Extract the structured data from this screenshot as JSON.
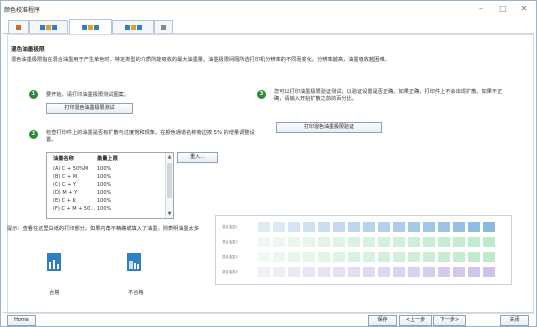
{
  "window": {
    "title": "颜色校准程序",
    "controls": [
      "–",
      "□",
      "✕"
    ]
  },
  "tabs": [
    {
      "icons": [
        "printer"
      ],
      "active": false
    },
    {
      "icons": [
        "arrow",
        "arrow",
        "arrow"
      ],
      "active": false
    },
    {
      "icons": [
        "arrow",
        "arrow",
        "arrow"
      ],
      "active": true
    },
    {
      "icons": [
        "arrow",
        "arrow",
        "arrow"
      ],
      "active": false
    },
    {
      "icons": [
        "grid"
      ],
      "active": false
    }
  ],
  "content": {
    "heading": "混色油墨极限",
    "description": "混色油墨极限指在混合油墨用于产生单色时，特定类型的介质所能吸收的最大油墨量。油墨极限间隔所选打印机分辨率的不同而变化。分辨率越高，油墨吸收越困难。",
    "step1": {
      "text": "要开始，请打印油墨极限测试图案。",
      "button": "打印混色油墨极限测试"
    },
    "step2": {
      "text": "检查打印件上的油墨是否有扩散与过度饱和现象。在颜色通道名称旁边按 5% 的增量调整设置。",
      "button": "重入..."
    },
    "step3": {
      "text": "您可以打印油墨极限验证测试，以验证设置是否正确。如果正确，打印件上不会出现扩散。如果不正确，请输入开始扩散之前的百分比。",
      "button": "打印混色油墨极限验证"
    },
    "table": {
      "headers": [
        "油墨名称",
        "墨量上限"
      ],
      "rows": [
        [
          "(A) C + 50%M",
          "100%"
        ],
        [
          "(B) C + M",
          "100%"
        ],
        [
          "(C) C + Y",
          "100%"
        ],
        [
          "(D) M + Y",
          "100%"
        ],
        [
          "(E) C + K",
          "100%"
        ],
        [
          "(F) C + M + 50...",
          "100%"
        ]
      ]
    },
    "prompt": "提示：查看在这里白纸的打印部分。如果内角不精确或填入了油墨，则表明油墨太多",
    "results": {
      "pass": "合格",
      "fail": "不合格"
    },
    "sample_rows": [
      "混合油墨1",
      "混合油墨2",
      "混合油墨3",
      "混合油墨4"
    ]
  },
  "footer": {
    "home": "Home",
    "save": "保存",
    "back": "<上一步",
    "next": "下一步>",
    "close": "关闭"
  },
  "colors": {
    "accent": "#2f7fc1",
    "step_green": "#2e8b3a",
    "swatch_blue": "#7fb3de",
    "swatch_green": "#b9e7c7",
    "swatch_purple": "#c8bde8"
  }
}
